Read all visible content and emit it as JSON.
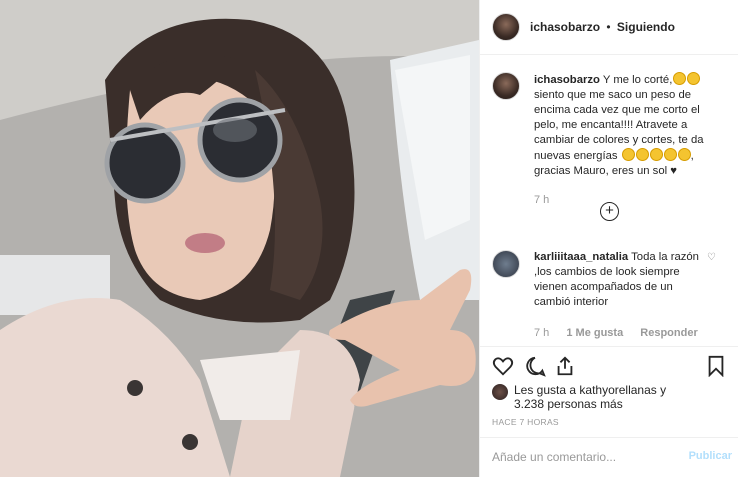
{
  "header": {
    "username": "ichasobarzo",
    "separator": "•",
    "follow_status": "Siguiendo"
  },
  "caption": {
    "username": "ichasobarzo",
    "text_1": "Y me lo corté",
    "text_2": "siento que me saco un peso de encima cada vez que me corto el pelo, me encanta!!!! Atravete a cambiar de colores y cortes, te da nuevas energías",
    "text_3": "gracias Mauro, eres un sol",
    "heart_glyph": "♥",
    "time": "7 h"
  },
  "comment": {
    "username": "karliiitaaa_natalia",
    "text": "Toda la razón ,los cambios de look siempre vienen acompañados de un cambió interior",
    "time": "7 h",
    "likes": "1 Me gusta",
    "reply": "Responder"
  },
  "likes_line": {
    "prefix": "Les gusta a ",
    "user": "kathyorellanas",
    "middle": " y",
    "count": "3.238 personas más"
  },
  "timestamp": "HACE 7 HORAS",
  "add_comment": {
    "placeholder": "Añade un comentario...",
    "publish": "Publicar"
  },
  "icons": {
    "like": "heart-icon",
    "comment": "comment-icon",
    "share": "share-icon",
    "save": "bookmark-icon",
    "expand": "plus-circle-icon"
  }
}
